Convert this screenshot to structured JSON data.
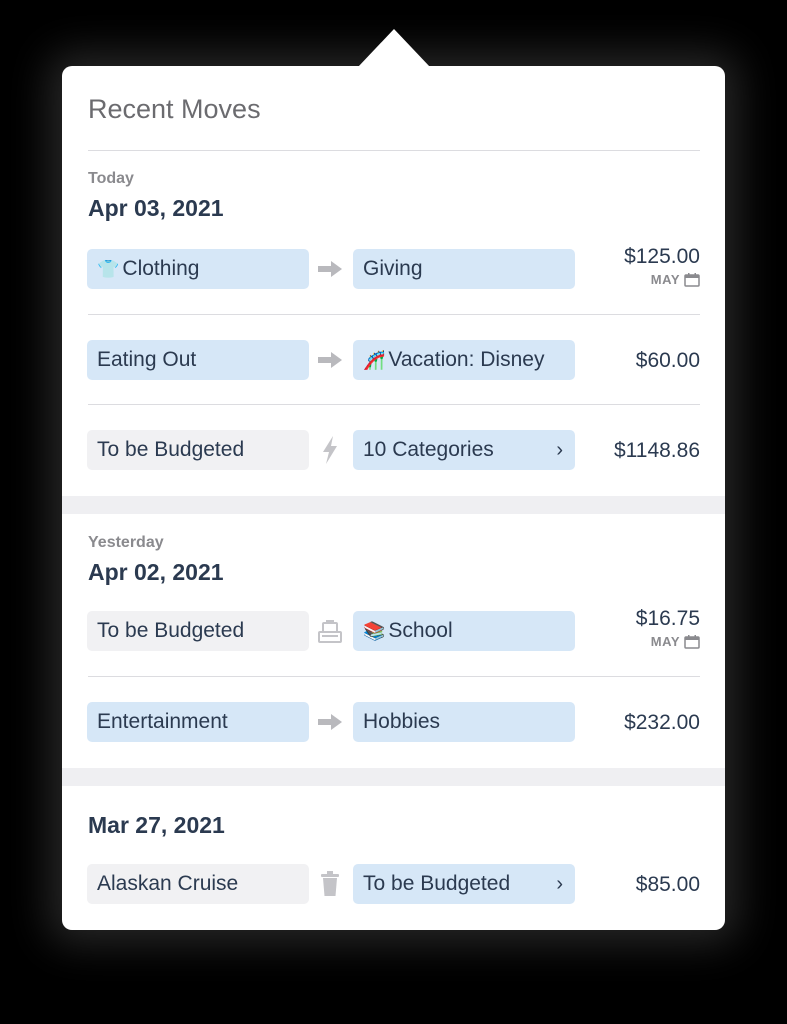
{
  "title": "Recent Moves",
  "groups": [
    {
      "day_label": "Today",
      "date": "Apr 03, 2021",
      "moves": [
        {
          "from": "Clothing",
          "from_icon": "👕",
          "to": "Giving",
          "action_icon": "arrow-right-icon",
          "amount": "$125.00",
          "month": "MAY"
        },
        {
          "from": "Eating Out",
          "to": "Vacation: Disney",
          "to_icon": "🎢",
          "action_icon": "arrow-right-icon",
          "amount": "$60.00"
        },
        {
          "from": "To be Budgeted",
          "to": "10 Categories",
          "action_icon": "lightning-icon",
          "amount": "$1148.86"
        }
      ]
    },
    {
      "day_label": "Yesterday",
      "date": "Apr 02, 2021",
      "moves": [
        {
          "from": "To be Budgeted",
          "to": "School",
          "to_icon": "📚",
          "action_icon": "fund-transfer-icon",
          "amount": "$16.75",
          "month": "MAY"
        },
        {
          "from": "Entertainment",
          "to": "Hobbies",
          "action_icon": "arrow-right-icon",
          "amount": "$232.00"
        }
      ]
    },
    {
      "date": "Mar 27, 2021",
      "moves": [
        {
          "from": "Alaskan Cruise",
          "to": "To be Budgeted",
          "action_icon": "trash-icon",
          "amount": "$85.00"
        }
      ]
    }
  ],
  "colors": {
    "accent_pill": "#d6e7f7",
    "neutral_pill": "#f1f1f3",
    "text": "#2b3a50",
    "muted": "#8a8a8e"
  }
}
